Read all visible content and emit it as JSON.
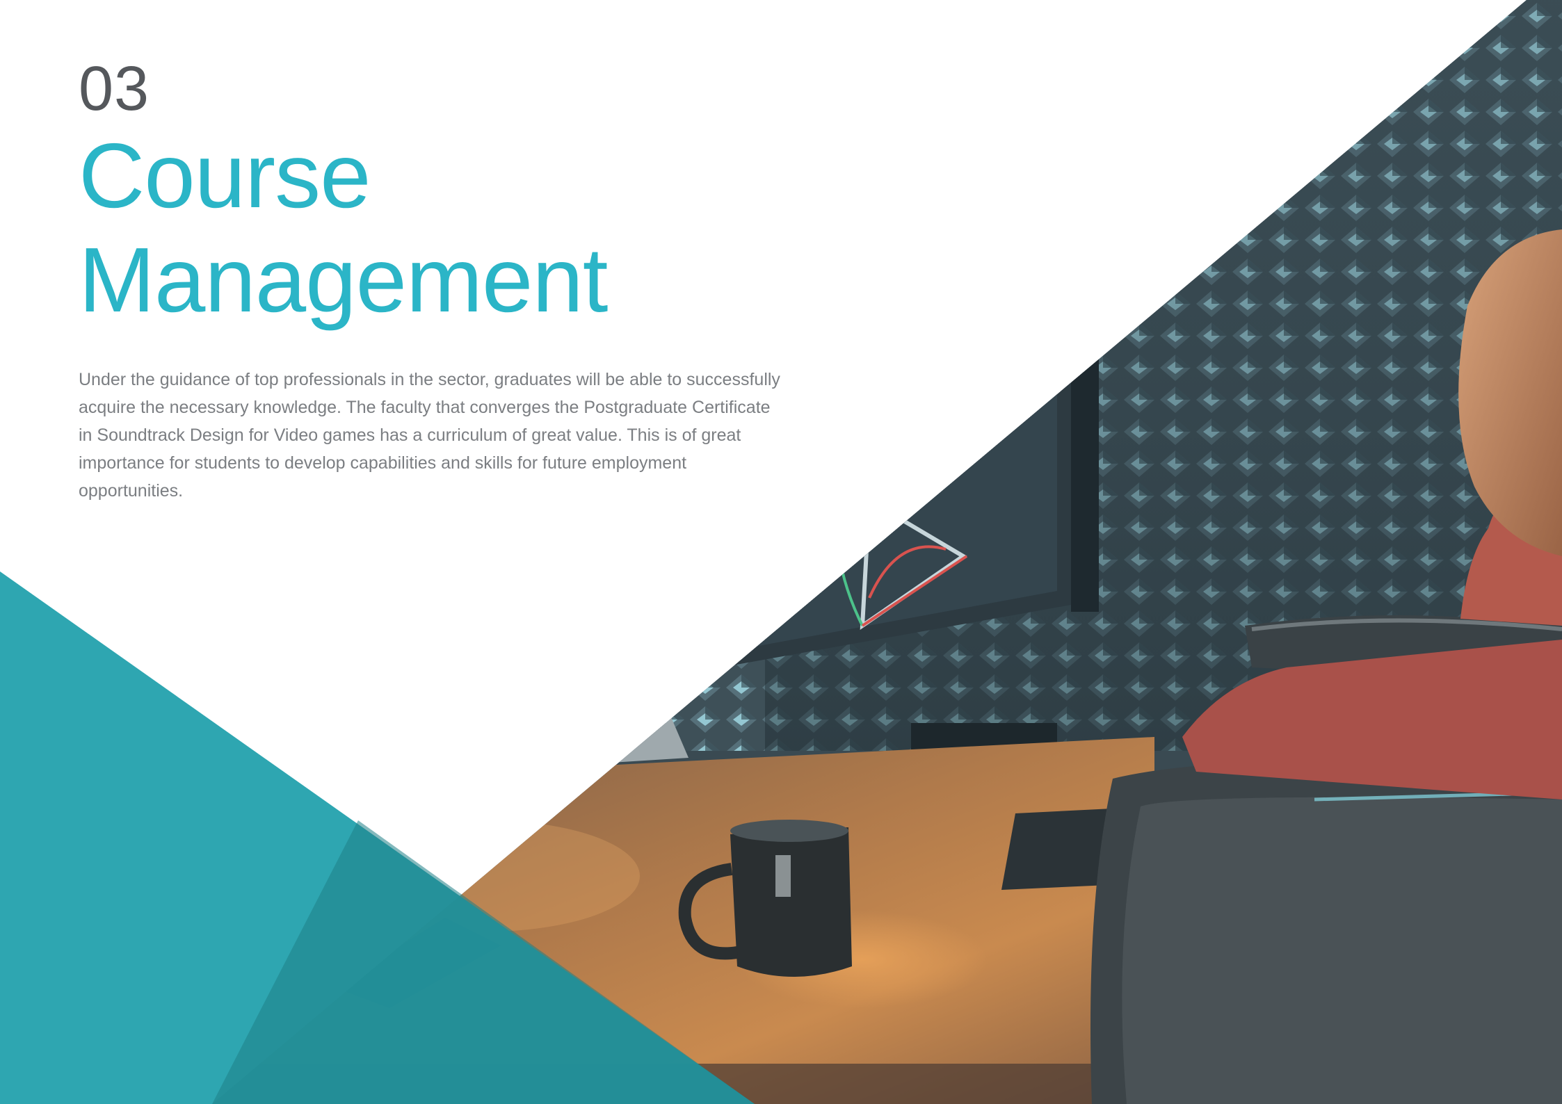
{
  "section": {
    "number": "03",
    "title": "Course Management",
    "body": "Under the guidance of top professionals in the sector, graduates will be able to successfully acquire the necessary knowledge. The faculty that converges the Postgraduate Certificate in Soundtrack Design for Video games has a curriculum of great value. This is of great importance for students to develop capabilities and skills for future employment opportunities."
  },
  "colors": {
    "accent": "#2bb5c7",
    "teal_triangle": "#27a3ae",
    "number_text": "#55585c",
    "body_text": "#7b7e82",
    "background": "#ffffff"
  },
  "image": {
    "subject": "person at music studio desk with monitors, acoustic foam wall, mug, remotes and chair"
  }
}
